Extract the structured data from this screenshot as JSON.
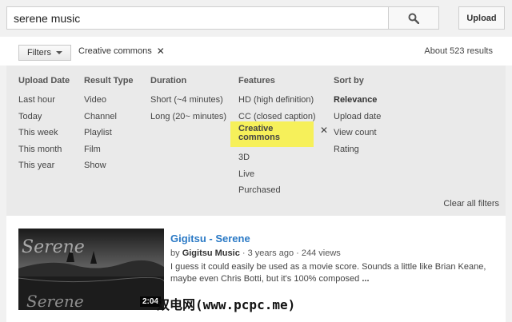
{
  "search": {
    "query": "serene music"
  },
  "header": {
    "upload_label": "Upload"
  },
  "filter_bar": {
    "filters_label": "Filters",
    "active_filter": "Creative commons",
    "results_count": "About 523 results"
  },
  "filter_panel": {
    "columns": [
      {
        "heading": "Upload Date",
        "items": [
          "Last hour",
          "Today",
          "This week",
          "This month",
          "This year"
        ]
      },
      {
        "heading": "Result Type",
        "items": [
          "Video",
          "Channel",
          "Playlist",
          "Film",
          "Show"
        ]
      },
      {
        "heading": "Duration",
        "items": [
          "Short (~4 minutes)",
          "Long (20~ minutes)"
        ]
      },
      {
        "heading": "Features",
        "items": [
          "HD (high definition)",
          "CC (closed caption)",
          "Creative commons",
          "3D",
          "Live",
          "Purchased"
        ]
      },
      {
        "heading": "Sort by",
        "items": [
          "Relevance",
          "Upload date",
          "View count",
          "Rating"
        ]
      }
    ],
    "clear_all": "Clear all filters"
  },
  "result": {
    "title": "Gigitsu - Serene",
    "by": "by",
    "channel": "Gigitsu Music",
    "age": "3 years ago",
    "views": "244 views",
    "description": "I guess it could easily be used as a movie score. Sounds a little like Brian Keane, maybe even Chris Botti, but it's 100% composed",
    "more": "...",
    "duration": "2:04",
    "thumb_text": "Serene"
  },
  "watermark": "双电网(www.pcpc.me)",
  "colors": {
    "highlight": "#f6f05a",
    "link": "#2a79c5",
    "panel": "#eaeaea"
  }
}
